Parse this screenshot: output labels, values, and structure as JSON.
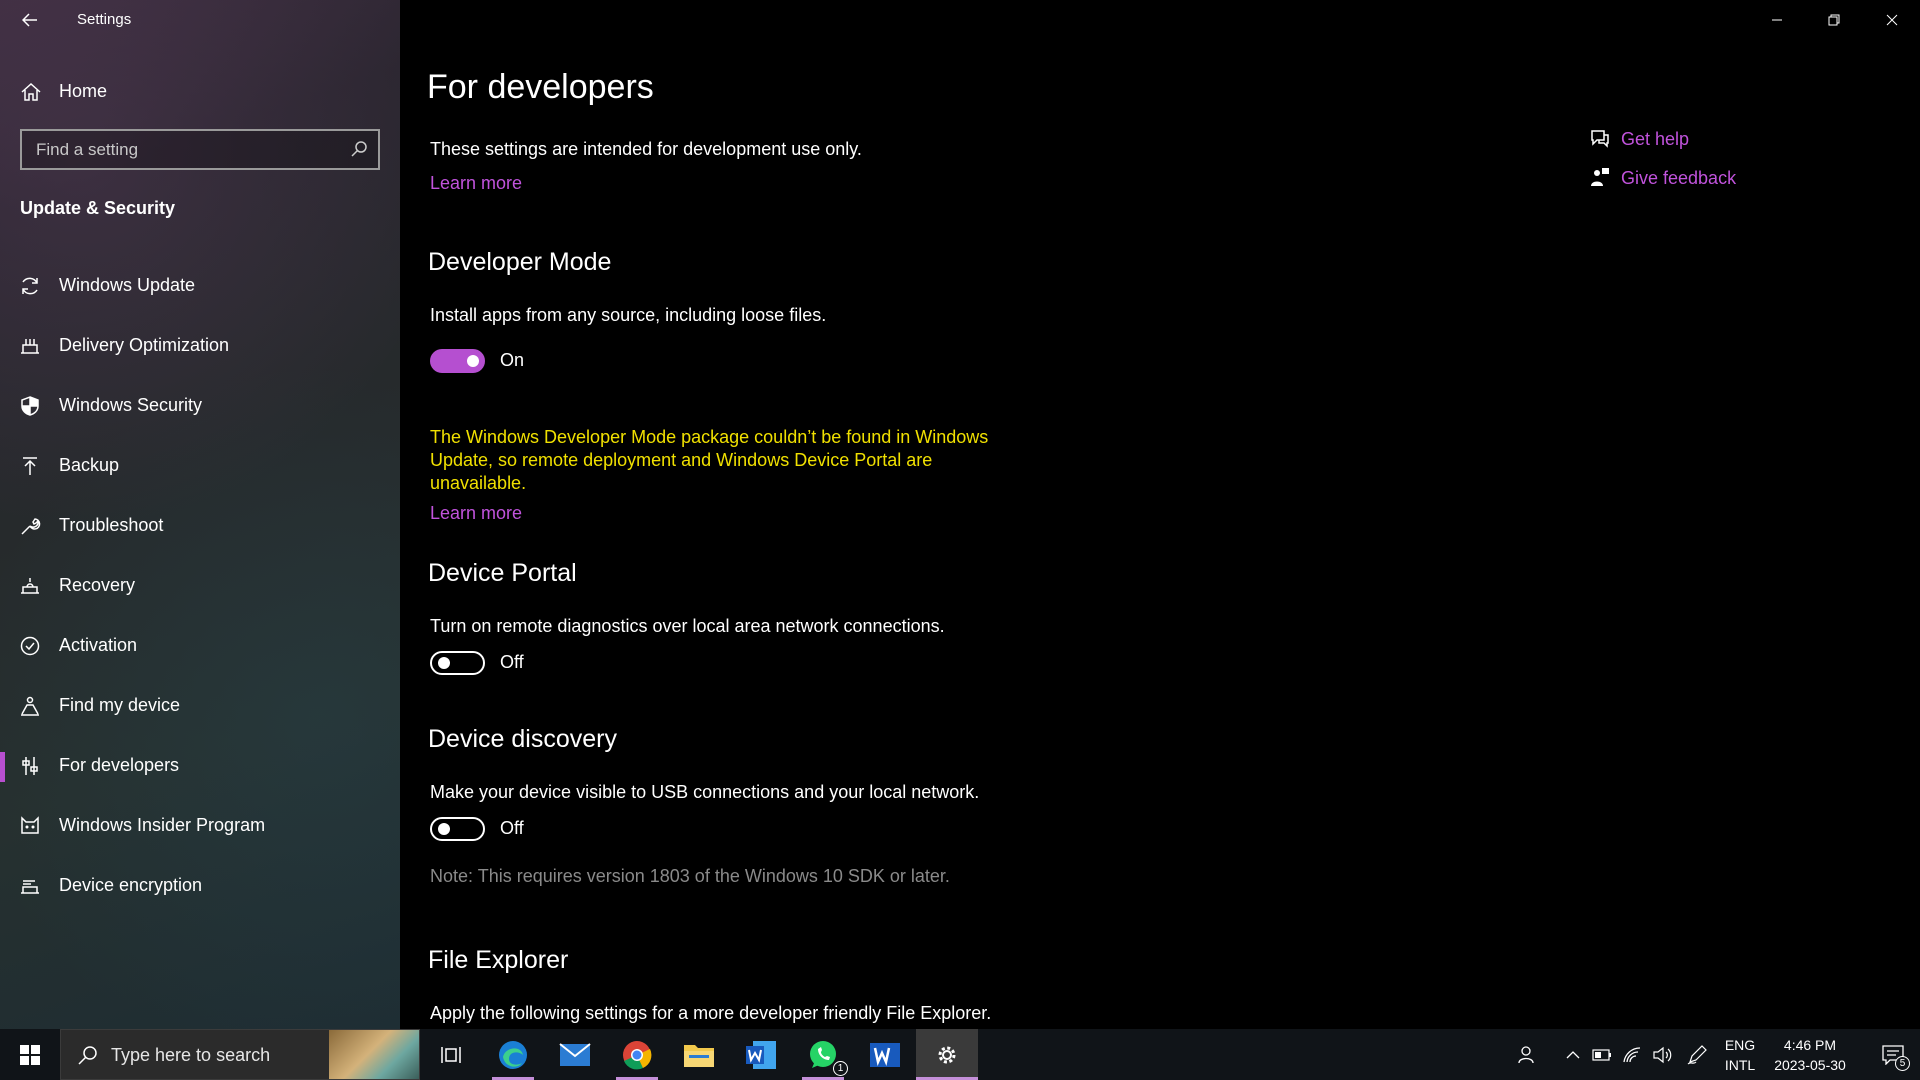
{
  "window": {
    "app_title": "Settings",
    "controls": [
      "minimize-icon",
      "restore-icon",
      "close-icon"
    ]
  },
  "sidebar": {
    "home_label": "Home",
    "search_placeholder": "Find a setting",
    "section_title": "Update & Security",
    "items": [
      {
        "label": "Windows Update",
        "icon": "refresh-icon",
        "active": false
      },
      {
        "label": "Delivery Optimization",
        "icon": "delivery-optimization-icon",
        "active": false
      },
      {
        "label": "Windows Security",
        "icon": "shield-icon",
        "active": false
      },
      {
        "label": "Backup",
        "icon": "backup-upload-icon",
        "active": false
      },
      {
        "label": "Troubleshoot",
        "icon": "wrench-icon",
        "active": false
      },
      {
        "label": "Recovery",
        "icon": "recovery-icon",
        "active": false
      },
      {
        "label": "Activation",
        "icon": "check-circle-icon",
        "active": false
      },
      {
        "label": "Find my device",
        "icon": "person-location-icon",
        "active": false
      },
      {
        "label": "For developers",
        "icon": "developer-sliders-icon",
        "active": true
      },
      {
        "label": "Windows Insider Program",
        "icon": "insider-cat-icon",
        "active": false
      },
      {
        "label": "Device encryption",
        "icon": "encryption-icon",
        "active": false
      }
    ]
  },
  "main": {
    "title": "For developers",
    "intro": "These settings are intended for development use only.",
    "intro_link": "Learn more",
    "developer_mode": {
      "heading": "Developer Mode",
      "desc": "Install apps from any source, including loose files.",
      "state": "On",
      "warning": "The Windows Developer Mode package couldn’t be found in Windows Update, so remote deployment and Windows Device Portal are unavailable.",
      "link": "Learn more"
    },
    "device_portal": {
      "heading": "Device Portal",
      "desc": "Turn on remote diagnostics over local area network connections.",
      "state": "Off"
    },
    "device_discovery": {
      "heading": "Device discovery",
      "desc": "Make your device visible to USB connections and your local network.",
      "state": "Off",
      "note": "Note: This requires version 1803 of the Windows 10 SDK or later."
    },
    "file_explorer": {
      "heading": "File Explorer",
      "desc": "Apply the following settings for a more developer friendly File Explorer."
    },
    "help": {
      "get_help": "Get help",
      "give_feedback": "Give feedback"
    }
  },
  "taskbar": {
    "search_placeholder": "Type here to search",
    "apps": [
      "task-view-icon",
      "edge-icon",
      "mail-icon",
      "chrome-icon",
      "file-explorer-icon",
      "word-icon",
      "whatsapp-icon",
      "word-icon",
      "settings-gear-icon"
    ],
    "whatsapp_badge": "1",
    "lang_line1": "ENG",
    "lang_line2": "INTL",
    "time": "4:46 PM",
    "date": "2023-05-30",
    "notification_count": "5"
  },
  "colors": {
    "accent": "#b54fd0",
    "link": "#c153dc",
    "warning": "#f0e000",
    "note": "#8a8a8a"
  }
}
